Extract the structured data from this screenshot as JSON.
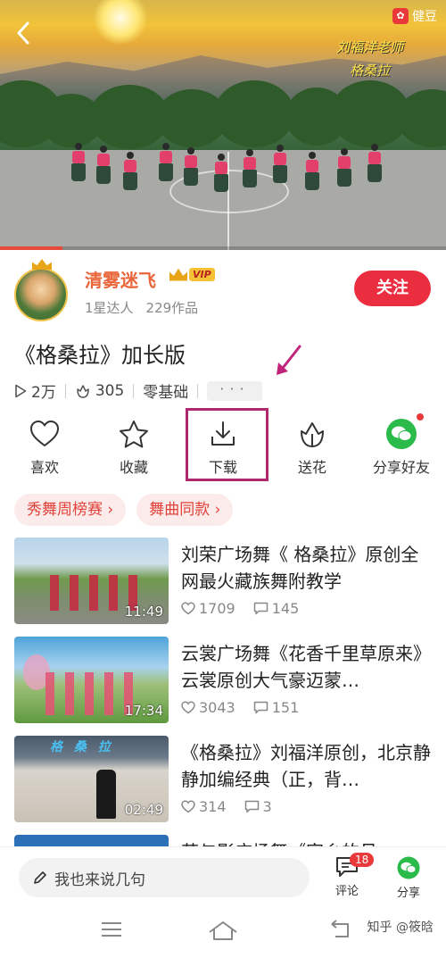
{
  "video": {
    "teacher_line1": "刘福洋老师",
    "teacher_line2": "格桑拉",
    "brand": "健豆",
    "progress": 0.14
  },
  "author": {
    "name": "清雾迷飞",
    "vip_label": "VIP",
    "level": "1星达人",
    "works": "229作品",
    "follow_label": "关注"
  },
  "post": {
    "title": "《格桑拉》加长版",
    "plays": "2万",
    "likes": "305",
    "level_tag": "零基础",
    "more": "···"
  },
  "actions": [
    {
      "label": "喜欢",
      "icon": "heart-icon"
    },
    {
      "label": "收藏",
      "icon": "star-icon"
    },
    {
      "label": "下载",
      "icon": "download-icon"
    },
    {
      "label": "送花",
      "icon": "flower-icon"
    },
    {
      "label": "分享好友",
      "icon": "wechat-icon"
    }
  ],
  "chips": [
    {
      "label": "秀舞周榜赛 ›"
    },
    {
      "label": "舞曲同款 ›"
    }
  ],
  "recommendations": [
    {
      "title": "刘荣广场舞《 格桑拉》原创全网最火藏族舞附教学",
      "duration": "11:49",
      "likes": "1709",
      "comments": "145"
    },
    {
      "title": "云裳广场舞《花香千里草原来》云裳原创大气豪迈蒙…",
      "duration": "17:34",
      "likes": "3043",
      "comments": "151"
    },
    {
      "title": "《格桑拉》刘福洋原创，北京静静加编经典（正，背…",
      "duration": "02:49",
      "likes": "314",
      "comments": "3"
    },
    {
      "title": "若与影广场舞《家乡的月…",
      "duration": "",
      "likes": "",
      "comments": ""
    }
  ],
  "bottom_bar": {
    "comment_placeholder": "我也来说几句",
    "comment_label": "评论",
    "comment_count": "18",
    "share_label": "分享"
  },
  "watermark": "知乎 @筱晗",
  "colors": {
    "accent_red": "#ea2d3f",
    "author_orange": "#e8663a",
    "highlight_box": "#b0286e",
    "wechat_green": "#2bbb4a"
  }
}
